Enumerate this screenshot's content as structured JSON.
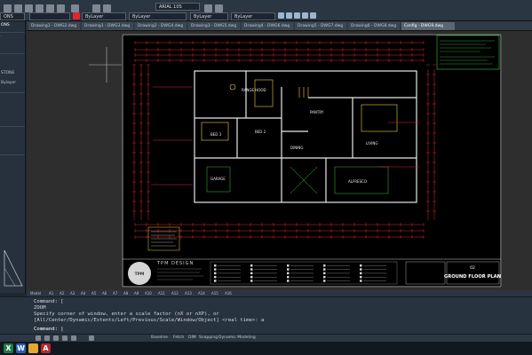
{
  "toolbar": {
    "combos": [
      "ONS",
      "",
      "",
      "ByLayer",
      "ByLayer",
      "ByLayer",
      "ARIAL 10S"
    ],
    "style_combo": "ARIAL 10S",
    "layer_combo": "ByLayer",
    "linetype_combo": "ByLayer",
    "lineweight_combo": "ByLayer",
    "color_combo": "ByLayer",
    "color_swatch": "#e0262b"
  },
  "left_panel": {
    "labels": [
      "ONS",
      "STONE",
      "Bylayer",
      "",
      ""
    ]
  },
  "doc_tabs": [
    {
      "label": "Drawing1 - DWG2.dwg",
      "active": false
    },
    {
      "label": "Drawing1 - DWG3.dwg",
      "active": false
    },
    {
      "label": "Drawing2 - DWG4.dwg",
      "active": false
    },
    {
      "label": "Drawing3 - DWG5.dwg",
      "active": false
    },
    {
      "label": "Drawing4 - DWG6.dwg",
      "active": false
    },
    {
      "label": "Drawing5 - DWG7.dwg",
      "active": false
    },
    {
      "label": "Drawing6 - DWG8.dwg",
      "active": false
    },
    {
      "label": "Config - DWG9.dwg",
      "active": true
    }
  ],
  "drawing": {
    "title": "GROUND FLOOR PLAN",
    "logo": "TPM",
    "company": "TPM DESIGN",
    "room_labels": [
      "RANGE HOOD",
      "PANTRY",
      "BED 2",
      "BED 3",
      "LIVING",
      "DINING",
      "GARAGE",
      "ALFRESCO"
    ],
    "sheet_no": "02"
  },
  "layout_tabs": [
    "Model",
    "A1",
    "A2",
    "A3",
    "A4",
    "A5",
    "A6",
    "A7",
    "A8",
    "A9",
    "A10",
    "A11",
    "A12",
    "A13",
    "A14",
    "A15",
    "A16"
  ],
  "command": {
    "lines": [
      "Command: [",
      "ZOOM",
      "Specify corner of window, enter a scale factor (nX or nXP), or",
      "[All/Center/Dynamic/Extents/Left/Previous/Scale/Window/Object] <real time>: a"
    ],
    "prompt": "Command: |"
  },
  "status_bar": [
    "Baseline",
    "Fetch",
    "DIM",
    "Snapping",
    "Dynamic Modeling"
  ],
  "taskbar": [
    {
      "name": "microsoft-excel-icon",
      "color": "#1d7a45",
      "label": "X"
    },
    {
      "name": "microsoft-word-icon",
      "color": "#2b5fb4",
      "label": "W"
    },
    {
      "name": "file-explorer-icon",
      "color": "#e2a830",
      "label": ""
    },
    {
      "name": "autocad-icon",
      "color": "#b7282e",
      "label": "A"
    }
  ]
}
